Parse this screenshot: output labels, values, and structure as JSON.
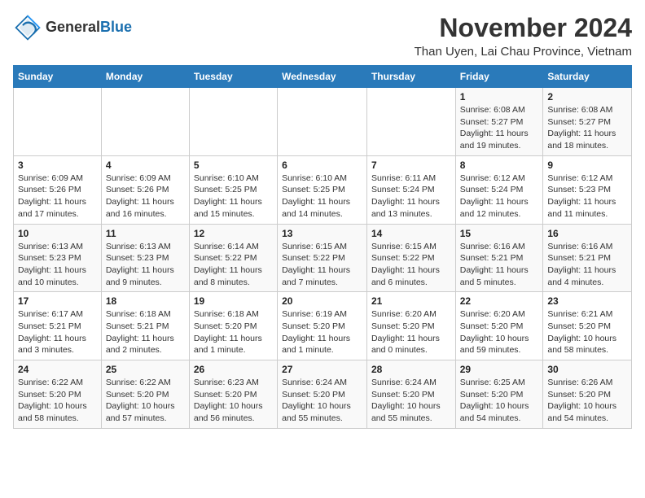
{
  "header": {
    "logo_general": "General",
    "logo_blue": "Blue",
    "month_year": "November 2024",
    "location": "Than Uyen, Lai Chau Province, Vietnam"
  },
  "days_of_week": [
    "Sunday",
    "Monday",
    "Tuesday",
    "Wednesday",
    "Thursday",
    "Friday",
    "Saturday"
  ],
  "weeks": [
    [
      {
        "day": "",
        "info": ""
      },
      {
        "day": "",
        "info": ""
      },
      {
        "day": "",
        "info": ""
      },
      {
        "day": "",
        "info": ""
      },
      {
        "day": "",
        "info": ""
      },
      {
        "day": "1",
        "info": "Sunrise: 6:08 AM\nSunset: 5:27 PM\nDaylight: 11 hours and 19 minutes."
      },
      {
        "day": "2",
        "info": "Sunrise: 6:08 AM\nSunset: 5:27 PM\nDaylight: 11 hours and 18 minutes."
      }
    ],
    [
      {
        "day": "3",
        "info": "Sunrise: 6:09 AM\nSunset: 5:26 PM\nDaylight: 11 hours and 17 minutes."
      },
      {
        "day": "4",
        "info": "Sunrise: 6:09 AM\nSunset: 5:26 PM\nDaylight: 11 hours and 16 minutes."
      },
      {
        "day": "5",
        "info": "Sunrise: 6:10 AM\nSunset: 5:25 PM\nDaylight: 11 hours and 15 minutes."
      },
      {
        "day": "6",
        "info": "Sunrise: 6:10 AM\nSunset: 5:25 PM\nDaylight: 11 hours and 14 minutes."
      },
      {
        "day": "7",
        "info": "Sunrise: 6:11 AM\nSunset: 5:24 PM\nDaylight: 11 hours and 13 minutes."
      },
      {
        "day": "8",
        "info": "Sunrise: 6:12 AM\nSunset: 5:24 PM\nDaylight: 11 hours and 12 minutes."
      },
      {
        "day": "9",
        "info": "Sunrise: 6:12 AM\nSunset: 5:23 PM\nDaylight: 11 hours and 11 minutes."
      }
    ],
    [
      {
        "day": "10",
        "info": "Sunrise: 6:13 AM\nSunset: 5:23 PM\nDaylight: 11 hours and 10 minutes."
      },
      {
        "day": "11",
        "info": "Sunrise: 6:13 AM\nSunset: 5:23 PM\nDaylight: 11 hours and 9 minutes."
      },
      {
        "day": "12",
        "info": "Sunrise: 6:14 AM\nSunset: 5:22 PM\nDaylight: 11 hours and 8 minutes."
      },
      {
        "day": "13",
        "info": "Sunrise: 6:15 AM\nSunset: 5:22 PM\nDaylight: 11 hours and 7 minutes."
      },
      {
        "day": "14",
        "info": "Sunrise: 6:15 AM\nSunset: 5:22 PM\nDaylight: 11 hours and 6 minutes."
      },
      {
        "day": "15",
        "info": "Sunrise: 6:16 AM\nSunset: 5:21 PM\nDaylight: 11 hours and 5 minutes."
      },
      {
        "day": "16",
        "info": "Sunrise: 6:16 AM\nSunset: 5:21 PM\nDaylight: 11 hours and 4 minutes."
      }
    ],
    [
      {
        "day": "17",
        "info": "Sunrise: 6:17 AM\nSunset: 5:21 PM\nDaylight: 11 hours and 3 minutes."
      },
      {
        "day": "18",
        "info": "Sunrise: 6:18 AM\nSunset: 5:21 PM\nDaylight: 11 hours and 2 minutes."
      },
      {
        "day": "19",
        "info": "Sunrise: 6:18 AM\nSunset: 5:20 PM\nDaylight: 11 hours and 1 minute."
      },
      {
        "day": "20",
        "info": "Sunrise: 6:19 AM\nSunset: 5:20 PM\nDaylight: 11 hours and 1 minute."
      },
      {
        "day": "21",
        "info": "Sunrise: 6:20 AM\nSunset: 5:20 PM\nDaylight: 11 hours and 0 minutes."
      },
      {
        "day": "22",
        "info": "Sunrise: 6:20 AM\nSunset: 5:20 PM\nDaylight: 10 hours and 59 minutes."
      },
      {
        "day": "23",
        "info": "Sunrise: 6:21 AM\nSunset: 5:20 PM\nDaylight: 10 hours and 58 minutes."
      }
    ],
    [
      {
        "day": "24",
        "info": "Sunrise: 6:22 AM\nSunset: 5:20 PM\nDaylight: 10 hours and 58 minutes."
      },
      {
        "day": "25",
        "info": "Sunrise: 6:22 AM\nSunset: 5:20 PM\nDaylight: 10 hours and 57 minutes."
      },
      {
        "day": "26",
        "info": "Sunrise: 6:23 AM\nSunset: 5:20 PM\nDaylight: 10 hours and 56 minutes."
      },
      {
        "day": "27",
        "info": "Sunrise: 6:24 AM\nSunset: 5:20 PM\nDaylight: 10 hours and 55 minutes."
      },
      {
        "day": "28",
        "info": "Sunrise: 6:24 AM\nSunset: 5:20 PM\nDaylight: 10 hours and 55 minutes."
      },
      {
        "day": "29",
        "info": "Sunrise: 6:25 AM\nSunset: 5:20 PM\nDaylight: 10 hours and 54 minutes."
      },
      {
        "day": "30",
        "info": "Sunrise: 6:26 AM\nSunset: 5:20 PM\nDaylight: 10 hours and 54 minutes."
      }
    ]
  ]
}
